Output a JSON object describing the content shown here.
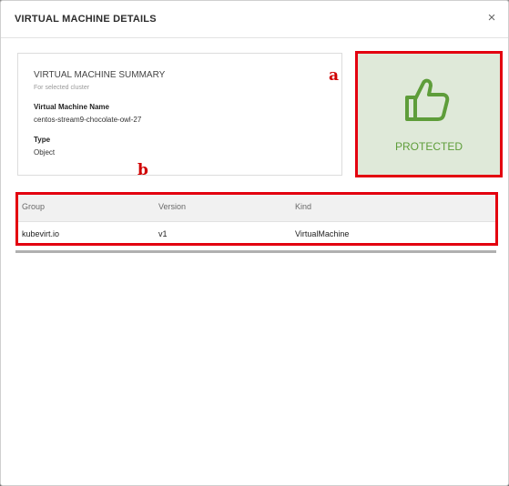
{
  "modal": {
    "title": "VIRTUAL MACHINE DETAILS",
    "close_symbol": "×"
  },
  "summary": {
    "title": "VIRTUAL MACHINE SUMMARY",
    "subtitle": "For selected cluster",
    "name_label": "Virtual Machine Name",
    "name_value": "centos-stream9-chocolate-owl-27",
    "type_label": "Type",
    "type_value": "Object"
  },
  "status": {
    "icon": "thumbs-up-icon",
    "text": "PROTECTED",
    "color": "#5e9d3a",
    "background": "#dfe9d9"
  },
  "annotations": {
    "a": "a",
    "b": "b",
    "color": "#e3000f"
  },
  "table": {
    "headers": [
      "Group",
      "Version",
      "Kind"
    ],
    "rows": [
      [
        "kubevirt.io",
        "v1",
        "VirtualMachine"
      ]
    ]
  }
}
